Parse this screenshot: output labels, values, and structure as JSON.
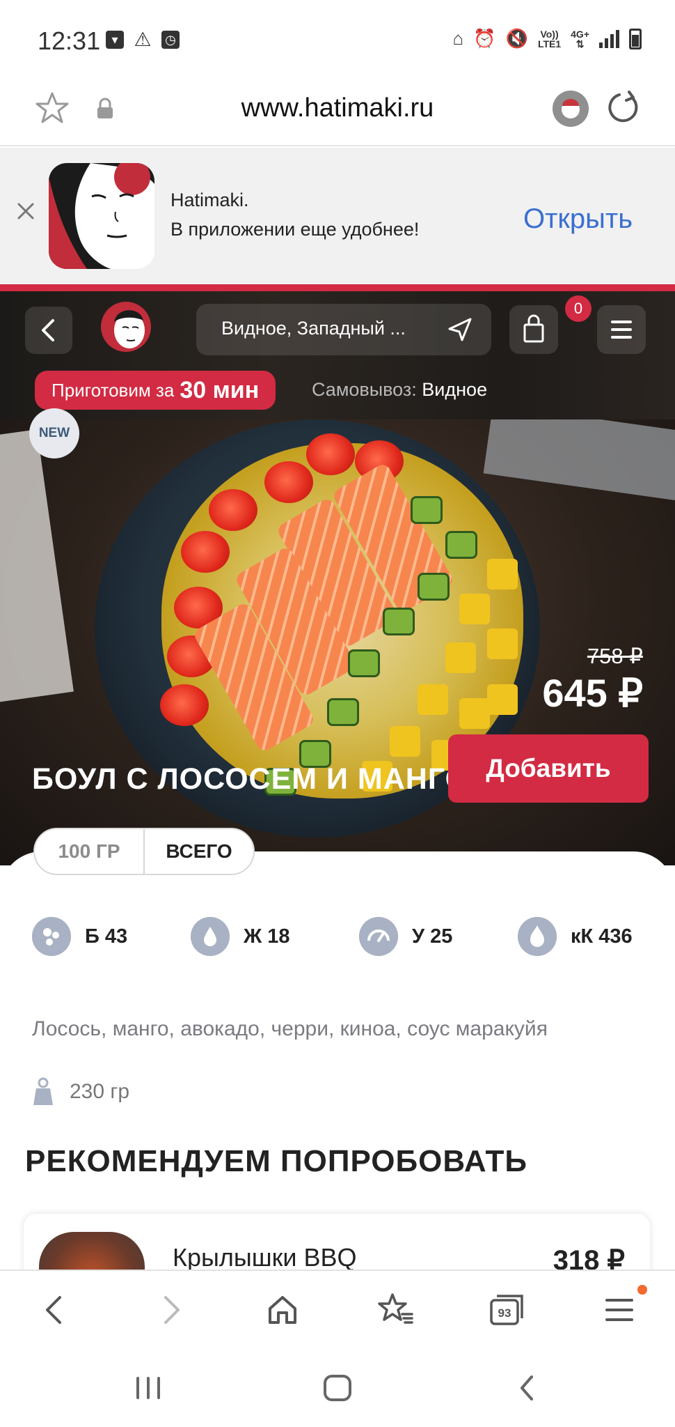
{
  "status_bar": {
    "time": "12:31",
    "network_top": "Vo))",
    "network_bottom": "LTE1",
    "data_type": "4G+"
  },
  "browser": {
    "url": "www.hatimaki.ru"
  },
  "app_banner": {
    "title": "Hatimaki.",
    "subtitle": "В приложении еще удобнее!",
    "open_label": "Открыть"
  },
  "header": {
    "address": "Видное, Западный ...",
    "cart_count": "0",
    "cook_prefix": "Приготовим за",
    "cook_time": "30 мин",
    "pickup_label": "Самовывоз:",
    "pickup_value": "Видное"
  },
  "product": {
    "badge": "NEW",
    "old_price": "758 ₽",
    "price": "645 ₽",
    "title": "БОУЛ С ЛОСОСЕМ И МАНГО",
    "add_label": "Добавить",
    "toggle": [
      "100 ГР",
      "ВСЕГО"
    ],
    "nutrition": [
      {
        "icon": "protein-icon",
        "value": "Б 43"
      },
      {
        "icon": "fat-drop-icon",
        "value": "Ж 18"
      },
      {
        "icon": "carbs-gauge-icon",
        "value": "У 25"
      },
      {
        "icon": "calories-flame-icon",
        "value": "кК 436"
      }
    ],
    "ingredients": "Лосось, манго, авокадо, черри, киноа, соус маракуйя",
    "weight": "230 гр"
  },
  "recommend": {
    "title": "РЕКОМЕНДУЕМ ПОПРОБОВАТЬ",
    "items": [
      {
        "name": "Крылышки BBQ",
        "price": "318 ₽"
      }
    ]
  },
  "toolbar": {
    "tabs_count": "93"
  },
  "colors": {
    "brand_red": "#d22b43",
    "link_blue": "#3a6fd0",
    "menu_dot": "#f26a2f"
  }
}
